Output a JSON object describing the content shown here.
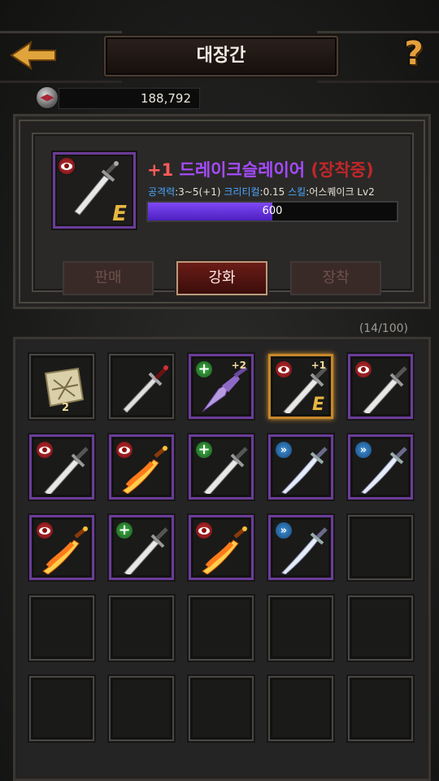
{
  "header": {
    "title": "대장간",
    "back_icon": "back-arrow-icon",
    "help_symbol": "?"
  },
  "currency": {
    "icon": "coin-icon",
    "amount": "188,792"
  },
  "selected_item": {
    "enhance": "+1",
    "name": "드레이크슬레이어",
    "equipped": "(장착중)",
    "stats": {
      "atk_label": "공격력",
      "atk_value": ":3~5(+1)",
      "crit_label": "크리티컬",
      "crit_value": ":0.15",
      "skill_label": "스킬",
      "skill_value": ":어스퀘이크 Lv2"
    },
    "progress_value": "600",
    "progress_fraction": 0.5,
    "equipped_mark": "E",
    "colors": {
      "enhance": "#ff5b5b",
      "name": "#a64bff",
      "equipped": "#c0272a"
    }
  },
  "actions": {
    "sell_label": "판매",
    "enhance_label": "강화",
    "equip_label": "장착"
  },
  "inventory": {
    "count_label": "(14/100)",
    "slots": [
      {
        "kind": "scroll",
        "qty": "2"
      },
      {
        "kind": "sword-red"
      },
      {
        "kind": "dagger-purple",
        "badge": "green",
        "plus": "+2"
      },
      {
        "kind": "dagger",
        "badge": "red",
        "plus": "+1",
        "mark": "E",
        "selected": true
      },
      {
        "kind": "dagger",
        "badge": "red"
      },
      {
        "kind": "dagger",
        "badge": "red"
      },
      {
        "kind": "flame",
        "badge": "red"
      },
      {
        "kind": "dagger",
        "badge": "green"
      },
      {
        "kind": "saber",
        "badge": "blue"
      },
      {
        "kind": "saber",
        "badge": "blue"
      },
      {
        "kind": "flame",
        "badge": "red"
      },
      {
        "kind": "dagger",
        "badge": "green"
      },
      {
        "kind": "flame",
        "badge": "red"
      },
      {
        "kind": "saber",
        "badge": "blue"
      }
    ]
  }
}
